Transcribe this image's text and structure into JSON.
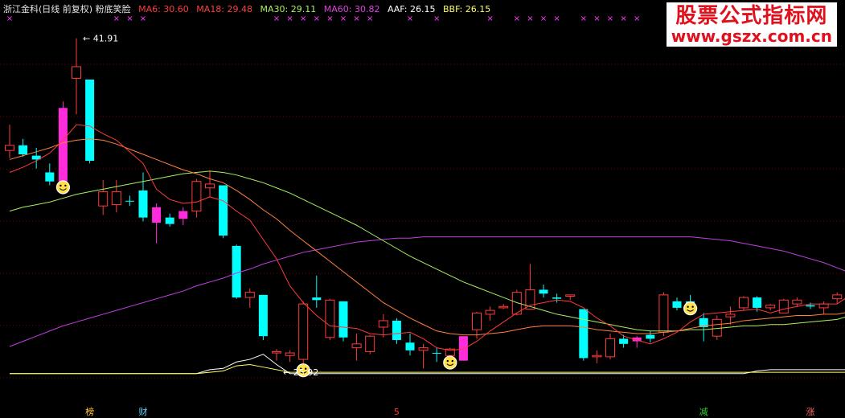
{
  "header": {
    "stock_label": "浙江金科(日线 前复权) 粉底笑脸",
    "indicators": [
      {
        "label": "MA6: 30.60",
        "color": "#ff3b3b"
      },
      {
        "label": "MA18: 29.48",
        "color": "#ff4040"
      },
      {
        "label": "MA30: 29.11",
        "color": "#a8f060"
      },
      {
        "label": "MA60: 30.82",
        "color": "#e040e0"
      },
      {
        "label": "AAF: 26.15",
        "color": "#ffffff"
      },
      {
        "label": "BBF: 26.15",
        "color": "#ffff66"
      }
    ]
  },
  "watermark": {
    "line1": "股票公式指标网",
    "line2": "www.gszx.com.cn"
  },
  "colors": {
    "background": "#000000",
    "up": "#ff3b3b",
    "down": "#00ffff",
    "highlight": "#ff2cdb",
    "ma6": "#ff3b3b",
    "ma18": "#ff8040",
    "ma30": "#a8f060",
    "ma60": "#c040e0",
    "aaf": "#ffffff",
    "bbf": "#ffff66",
    "marker": "#ff40ff",
    "grid": "#7a0000"
  },
  "chart_data": {
    "type": "candlestick",
    "price_range": [
      23.0,
      43.5
    ],
    "candles": [
      {
        "o": 33.2,
        "h": 35.2,
        "l": 32.6,
        "c": 33.6,
        "dir": "up"
      },
      {
        "o": 33.6,
        "h": 34.1,
        "l": 32.7,
        "c": 32.9,
        "dir": "down"
      },
      {
        "o": 32.8,
        "h": 33.4,
        "l": 31.8,
        "c": 32.5,
        "dir": "down"
      },
      {
        "o": 31.5,
        "h": 32.2,
        "l": 30.5,
        "c": 30.8,
        "dir": "down"
      },
      {
        "o": 30.8,
        "h": 37.0,
        "l": 30.6,
        "c": 36.5,
        "dir": "highlight"
      },
      {
        "o": 38.8,
        "h": 41.9,
        "l": 36.0,
        "c": 39.7,
        "dir": "up"
      },
      {
        "o": 38.7,
        "h": 38.7,
        "l": 32.2,
        "c": 32.4,
        "dir": "down"
      },
      {
        "o": 30.0,
        "h": 30.9,
        "l": 28.2,
        "c": 28.9,
        "dir": "up"
      },
      {
        "o": 29.0,
        "h": 30.9,
        "l": 28.4,
        "c": 30.0,
        "dir": "up"
      },
      {
        "o": 29.3,
        "h": 29.7,
        "l": 28.9,
        "c": 29.3,
        "dir": "down"
      },
      {
        "o": 30.1,
        "h": 31.5,
        "l": 27.7,
        "c": 28.0,
        "dir": "down"
      },
      {
        "o": 27.6,
        "h": 29.1,
        "l": 26.0,
        "c": 28.8,
        "dir": "highlight"
      },
      {
        "o": 28.0,
        "h": 28.3,
        "l": 27.3,
        "c": 27.5,
        "dir": "down"
      },
      {
        "o": 27.9,
        "h": 28.8,
        "l": 27.4,
        "c": 28.5,
        "dir": "highlight"
      },
      {
        "o": 28.5,
        "h": 31.0,
        "l": 28.0,
        "c": 30.8,
        "dir": "up"
      },
      {
        "o": 30.3,
        "h": 31.6,
        "l": 29.6,
        "c": 30.6,
        "dir": "up"
      },
      {
        "o": 30.5,
        "h": 30.5,
        "l": 26.4,
        "c": 26.6,
        "dir": "down"
      },
      {
        "o": 25.8,
        "h": 25.9,
        "l": 21.7,
        "c": 21.8,
        "dir": "down"
      },
      {
        "o": 21.8,
        "h": 22.5,
        "l": 21.0,
        "c": 22.2,
        "dir": "up"
      },
      {
        "o": 22.0,
        "h": 22.0,
        "l": 18.5,
        "c": 18.8,
        "dir": "down"
      },
      {
        "o": 17.5,
        "h": 17.8,
        "l": 16.9,
        "c": 17.6,
        "dir": "up"
      },
      {
        "o": 17.3,
        "h": 17.7,
        "l": 16.8,
        "c": 17.5,
        "dir": "up"
      },
      {
        "o": 17.0,
        "h": 21.5,
        "l": 16.4,
        "c": 21.3,
        "dir": "up"
      },
      {
        "o": 21.8,
        "h": 23.5,
        "l": 21.0,
        "c": 21.6,
        "dir": "down"
      },
      {
        "o": 21.6,
        "h": 21.7,
        "l": 18.5,
        "c": 18.7,
        "dir": "up"
      },
      {
        "o": 21.5,
        "h": 21.5,
        "l": 18.4,
        "c": 18.7,
        "dir": "down"
      },
      {
        "o": 17.9,
        "h": 19.0,
        "l": 16.9,
        "c": 18.2,
        "dir": "up"
      },
      {
        "o": 17.6,
        "h": 18.9,
        "l": 17.4,
        "c": 18.8,
        "dir": "up"
      },
      {
        "o": 19.5,
        "h": 20.5,
        "l": 18.7,
        "c": 20.0,
        "dir": "up"
      },
      {
        "o": 20.0,
        "h": 20.2,
        "l": 18.2,
        "c": 18.5,
        "dir": "down"
      },
      {
        "o": 18.3,
        "h": 19.0,
        "l": 17.3,
        "c": 17.7,
        "dir": "down"
      },
      {
        "o": 17.7,
        "h": 18.2,
        "l": 16.3,
        "c": 17.9,
        "dir": "up"
      },
      {
        "o": 17.5,
        "h": 17.9,
        "l": 16.8,
        "c": 17.5,
        "dir": "down"
      },
      {
        "o": 17.3,
        "h": 17.9,
        "l": 17.0,
        "c": 17.8,
        "dir": "up"
      },
      {
        "o": 16.9,
        "h": 18.7,
        "l": 16.9,
        "c": 18.8,
        "dir": "highlight"
      },
      {
        "o": 19.3,
        "h": 20.7,
        "l": 18.6,
        "c": 20.6,
        "dir": "up"
      },
      {
        "o": 20.5,
        "h": 21.1,
        "l": 20.0,
        "c": 20.8,
        "dir": "up"
      },
      {
        "o": 21.0,
        "h": 21.3,
        "l": 20.9,
        "c": 21.1,
        "dir": "up"
      },
      {
        "o": 20.5,
        "h": 22.4,
        "l": 20.4,
        "c": 22.2,
        "dir": "up"
      },
      {
        "o": 20.9,
        "h": 24.4,
        "l": 20.9,
        "c": 22.4,
        "dir": "up"
      },
      {
        "o": 22.4,
        "h": 22.8,
        "l": 21.8,
        "c": 22.1,
        "dir": "down"
      },
      {
        "o": 21.8,
        "h": 22.1,
        "l": 21.4,
        "c": 21.7,
        "dir": "down"
      },
      {
        "o": 21.9,
        "h": 22.0,
        "l": 21.6,
        "c": 22.0,
        "dir": "up"
      },
      {
        "o": 20.9,
        "h": 20.9,
        "l": 16.9,
        "c": 17.1,
        "dir": "down"
      },
      {
        "o": 17.2,
        "h": 17.7,
        "l": 16.7,
        "c": 17.3,
        "dir": "up"
      },
      {
        "o": 17.2,
        "h": 19.0,
        "l": 17.0,
        "c": 18.6,
        "dir": "up"
      },
      {
        "o": 18.2,
        "h": 18.9,
        "l": 17.9,
        "c": 18.6,
        "dir": "down"
      },
      {
        "o": 18.4,
        "h": 18.8,
        "l": 17.9,
        "c": 18.7,
        "dir": "highlight"
      },
      {
        "o": 18.9,
        "h": 19.2,
        "l": 18.3,
        "c": 18.6,
        "dir": "down"
      },
      {
        "o": 19.1,
        "h": 22.2,
        "l": 18.8,
        "c": 22.0,
        "dir": "up"
      },
      {
        "o": 21.0,
        "h": 21.8,
        "l": 20.8,
        "c": 21.5,
        "dir": "down"
      },
      {
        "o": 21.5,
        "h": 22.0,
        "l": 21.2,
        "c": 21.2,
        "dir": "down"
      },
      {
        "o": 20.2,
        "h": 20.6,
        "l": 18.4,
        "c": 19.5,
        "dir": "down"
      },
      {
        "o": 18.8,
        "h": 20.4,
        "l": 18.5,
        "c": 20.1,
        "dir": "up"
      },
      {
        "o": 20.3,
        "h": 21.1,
        "l": 19.7,
        "c": 20.5,
        "dir": "up"
      },
      {
        "o": 21.0,
        "h": 21.9,
        "l": 20.8,
        "c": 21.8,
        "dir": "up"
      },
      {
        "o": 21.8,
        "h": 21.9,
        "l": 20.7,
        "c": 21.0,
        "dir": "down"
      },
      {
        "o": 21.0,
        "h": 21.3,
        "l": 20.8,
        "c": 21.2,
        "dir": "up"
      },
      {
        "o": 20.6,
        "h": 21.7,
        "l": 20.6,
        "c": 21.6,
        "dir": "up"
      },
      {
        "o": 21.3,
        "h": 21.8,
        "l": 21.1,
        "c": 21.6,
        "dir": "up"
      },
      {
        "o": 21.1,
        "h": 21.4,
        "l": 20.9,
        "c": 21.2,
        "dir": "down"
      },
      {
        "o": 21.0,
        "h": 21.5,
        "l": 20.5,
        "c": 21.3,
        "dir": "up"
      },
      {
        "o": 21.7,
        "h": 22.2,
        "l": 21.3,
        "c": 22.0,
        "dir": "up"
      },
      {
        "o": 22.2,
        "h": 26.5,
        "l": 22.0,
        "c": 26.2,
        "dir": "up"
      }
    ],
    "ma6": [
      31.5,
      31.9,
      32.4,
      33.0,
      34.0,
      35.2,
      35.1,
      34.5,
      34.0,
      33.1,
      32.2,
      30.2,
      29.4,
      29.1,
      29.2,
      29.6,
      29.3,
      28.5,
      27.8,
      26.3,
      24.8,
      22.7,
      21.4,
      20.4,
      19.6,
      19.5,
      19.4,
      19.0,
      18.9,
      19.0,
      19.1,
      18.6,
      17.9,
      17.7,
      17.8,
      18.4,
      19.2,
      19.9,
      20.6,
      21.2,
      21.4,
      21.6,
      21.5,
      21.0,
      20.2,
      19.6,
      18.8,
      18.5,
      18.2,
      18.6,
      19.1,
      19.9,
      20.5,
      20.6,
      20.7,
      20.8,
      20.9,
      20.6,
      20.9,
      21.1,
      21.3,
      21.3,
      21.3,
      22.0
    ],
    "ma18": [
      32.5,
      32.8,
      33.1,
      33.4,
      33.8,
      34.0,
      34.1,
      34.0,
      33.7,
      33.3,
      32.9,
      32.5,
      32.1,
      31.7,
      31.4,
      31.0,
      30.7,
      30.1,
      29.4,
      28.6,
      27.9,
      27.0,
      26.2,
      25.4,
      24.6,
      23.8,
      23.0,
      22.2,
      21.4,
      20.8,
      20.2,
      19.7,
      19.2,
      19.0,
      18.9,
      18.9,
      19.0,
      19.1,
      19.3,
      19.5,
      19.6,
      19.6,
      19.6,
      19.5,
      19.3,
      19.2,
      19.1,
      19.0,
      19.0,
      19.1,
      19.2,
      19.4,
      19.6,
      19.7,
      19.8,
      20.0,
      20.1,
      20.2,
      20.3,
      20.4,
      20.4,
      20.5,
      20.5,
      20.7
    ],
    "ma30": [
      28.5,
      28.8,
      29.0,
      29.2,
      29.5,
      29.8,
      30.0,
      30.2,
      30.4,
      30.6,
      30.8,
      31.0,
      31.2,
      31.4,
      31.5,
      31.6,
      31.5,
      31.3,
      31.0,
      30.7,
      30.3,
      29.9,
      29.4,
      28.9,
      28.4,
      27.9,
      27.4,
      26.8,
      26.2,
      25.6,
      25.0,
      24.5,
      24.0,
      23.5,
      23.0,
      22.6,
      22.2,
      21.8,
      21.4,
      21.1,
      20.8,
      20.5,
      20.3,
      20.1,
      19.9,
      19.7,
      19.5,
      19.3,
      19.2,
      19.2,
      19.2,
      19.3,
      19.3,
      19.4,
      19.5,
      19.6,
      19.6,
      19.7,
      19.7,
      19.8,
      19.9,
      20.0,
      20.1,
      20.4
    ],
    "ma60": [
      18.0,
      18.4,
      18.8,
      19.2,
      19.6,
      19.9,
      20.2,
      20.5,
      20.8,
      21.1,
      21.4,
      21.7,
      22.0,
      22.3,
      22.7,
      23.0,
      23.3,
      23.7,
      24.0,
      24.4,
      24.7,
      25.0,
      25.3,
      25.5,
      25.7,
      25.9,
      26.1,
      26.2,
      26.3,
      26.4,
      26.4,
      26.5,
      26.5,
      26.5,
      26.5,
      26.5,
      26.5,
      26.5,
      26.5,
      26.5,
      26.5,
      26.5,
      26.5,
      26.5,
      26.5,
      26.5,
      26.5,
      26.5,
      26.5,
      26.5,
      26.5,
      26.5,
      26.4,
      26.3,
      26.2,
      26.0,
      25.8,
      25.6,
      25.4,
      25.1,
      24.8,
      24.5,
      24.1,
      23.7
    ],
    "aaf": [
      15.9,
      15.9,
      15.9,
      15.9,
      15.9,
      15.9,
      15.9,
      15.9,
      15.9,
      15.9,
      15.9,
      15.9,
      15.9,
      15.9,
      15.9,
      16.2,
      16.3,
      16.8,
      17.0,
      17.4,
      16.6,
      15.9,
      15.9,
      15.9,
      15.9,
      15.9,
      15.9,
      15.9,
      15.9,
      15.9,
      15.9,
      15.9,
      15.9,
      15.9,
      15.9,
      15.9,
      15.9,
      15.9,
      15.9,
      15.9,
      15.9,
      15.9,
      15.9,
      15.9,
      15.9,
      15.9,
      15.9,
      15.9,
      15.9,
      15.9,
      15.9,
      15.9,
      15.9,
      15.9,
      15.9,
      15.9,
      16.1,
      16.2,
      16.2,
      16.2,
      16.2,
      16.2,
      16.2,
      16.2
    ],
    "bbf": [
      15.9,
      15.9,
      15.9,
      15.9,
      15.9,
      15.9,
      15.9,
      15.9,
      15.9,
      15.9,
      15.9,
      15.9,
      15.9,
      15.9,
      15.9,
      16.0,
      16.1,
      16.5,
      16.6,
      16.4,
      16.2,
      16.0,
      16.0,
      16.0,
      16.0,
      16.0,
      16.0,
      16.0,
      16.0,
      16.0,
      16.0,
      16.0,
      16.0,
      16.0,
      16.0,
      16.0,
      16.0,
      16.0,
      16.0,
      16.0,
      16.0,
      16.0,
      16.0,
      16.0,
      16.0,
      16.0,
      16.0,
      16.0,
      16.0,
      16.0,
      16.0,
      16.0,
      16.0,
      16.0,
      16.0,
      16.0,
      16.0,
      16.0,
      16.0,
      16.0,
      16.0,
      16.0,
      16.0,
      16.0
    ],
    "smileys": [
      4,
      22,
      33,
      51
    ],
    "x_markers": [
      0,
      8,
      9,
      10,
      20,
      21,
      22,
      23,
      24,
      25,
      26,
      27,
      30,
      32,
      36,
      38,
      39,
      40,
      41,
      43,
      44,
      45,
      46,
      47
    ],
    "annotations": [
      {
        "index": 5,
        "price": 41.91,
        "text": "41.91"
      },
      {
        "index": 20,
        "price": 16.0,
        "text": "25.92"
      }
    ],
    "bottom_labels": [
      {
        "index": 6,
        "text": "榜",
        "color": "#ffcc33"
      },
      {
        "index": 10,
        "text": "财",
        "color": "#66ccff"
      },
      {
        "index": 29,
        "text": "5",
        "color": "#ff3333"
      },
      {
        "index": 52,
        "text": "减",
        "color": "#33cc33"
      },
      {
        "index": 60,
        "text": "涨",
        "color": "#ff6666"
      }
    ]
  }
}
